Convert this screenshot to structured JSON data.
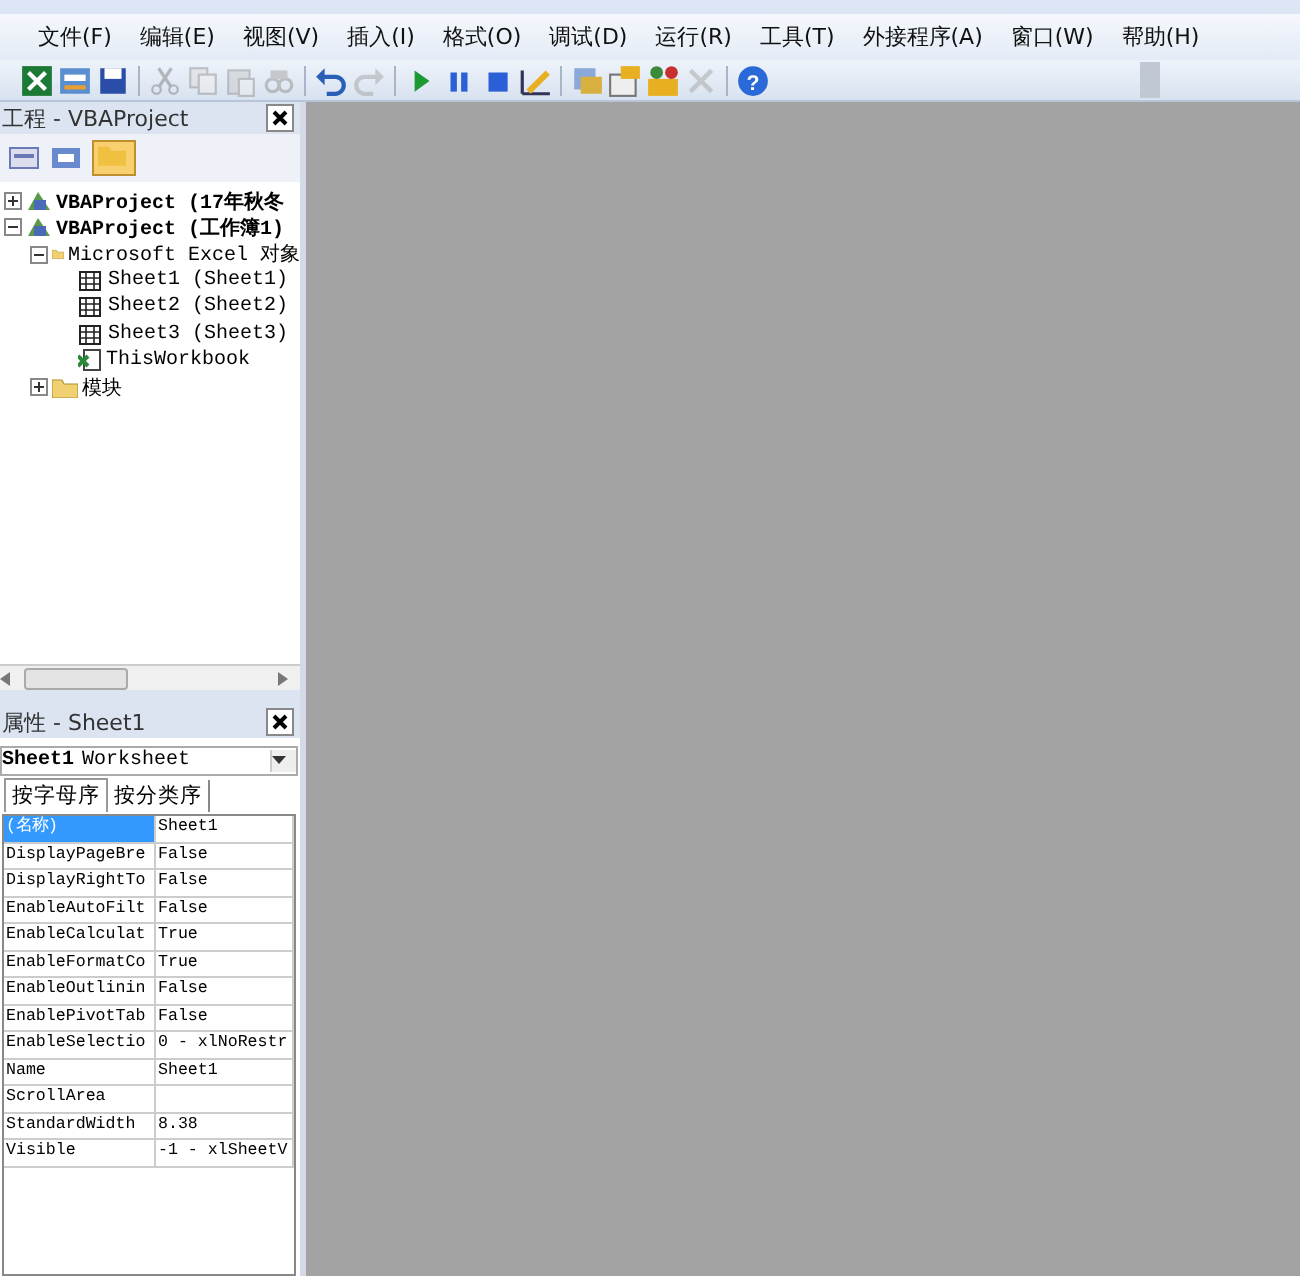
{
  "menu": [
    {
      "label": "文件(F)"
    },
    {
      "label": "编辑(E)"
    },
    {
      "label": "视图(V)"
    },
    {
      "label": "插入(I)"
    },
    {
      "label": "格式(O)"
    },
    {
      "label": "调试(D)"
    },
    {
      "label": "运行(R)"
    },
    {
      "label": "工具(T)"
    },
    {
      "label": "外接程序(A)"
    },
    {
      "label": "窗口(W)"
    },
    {
      "label": "帮助(H)"
    }
  ],
  "toolbar": [
    {
      "kind": "excel",
      "disabled": false
    },
    {
      "kind": "insert",
      "disabled": false
    },
    {
      "kind": "save",
      "disabled": false
    },
    {
      "kind": "sep"
    },
    {
      "kind": "cut",
      "disabled": true
    },
    {
      "kind": "copy",
      "disabled": true
    },
    {
      "kind": "paste",
      "disabled": true
    },
    {
      "kind": "find",
      "disabled": true
    },
    {
      "kind": "sep"
    },
    {
      "kind": "undo",
      "disabled": false
    },
    {
      "kind": "redo",
      "disabled": true
    },
    {
      "kind": "sep"
    },
    {
      "kind": "run",
      "disabled": false
    },
    {
      "kind": "pause",
      "disabled": false
    },
    {
      "kind": "stop",
      "disabled": false
    },
    {
      "kind": "design",
      "disabled": false
    },
    {
      "kind": "sep"
    },
    {
      "kind": "explorer",
      "disabled": false
    },
    {
      "kind": "properties",
      "disabled": false
    },
    {
      "kind": "browser",
      "disabled": false
    },
    {
      "kind": "toolbox",
      "disabled": true
    },
    {
      "kind": "sep"
    },
    {
      "kind": "help",
      "disabled": false,
      "label": "?"
    }
  ],
  "project": {
    "title": "工程 - VBAProject",
    "tree": [
      {
        "label": "VBAProject (17年秋冬",
        "kind": "project",
        "bold": true,
        "expanded": false
      },
      {
        "label": "VBAProject (工作簿1)",
        "kind": "project",
        "bold": true,
        "expanded": true,
        "children": [
          {
            "label": "Microsoft Excel 对象",
            "kind": "folder",
            "bold": false,
            "expanded": true,
            "children": [
              {
                "label": "Sheet1 (Sheet1)",
                "kind": "sheet",
                "bold": false
              },
              {
                "label": "Sheet2 (Sheet2)",
                "kind": "sheet",
                "bold": false
              },
              {
                "label": "Sheet3 (Sheet3)",
                "kind": "sheet",
                "bold": false
              },
              {
                "label": "ThisWorkbook",
                "kind": "workbook",
                "bold": false
              }
            ]
          },
          {
            "label": "模块",
            "kind": "folder",
            "bold": false,
            "expanded": false
          }
        ]
      }
    ]
  },
  "properties": {
    "title": "属性 - Sheet1",
    "object_name": "Sheet1",
    "object_type": "Worksheet",
    "tabs": [
      {
        "label": "按字母序",
        "selected": true
      },
      {
        "label": "按分类序",
        "selected": false
      }
    ],
    "rows": [
      {
        "name": "(名称)",
        "value": "Sheet1",
        "selected": true
      },
      {
        "name": "DisplayPageBre",
        "value": "False",
        "selected": false
      },
      {
        "name": "DisplayRightTo",
        "value": "False",
        "selected": false
      },
      {
        "name": "EnableAutoFilt",
        "value": "False",
        "selected": false
      },
      {
        "name": "EnableCalculat",
        "value": "True",
        "selected": false
      },
      {
        "name": "EnableFormatCo",
        "value": "True",
        "selected": false
      },
      {
        "name": "EnableOutlinin",
        "value": "False",
        "selected": false
      },
      {
        "name": "EnablePivotTab",
        "value": "False",
        "selected": false
      },
      {
        "name": "EnableSelectio",
        "value": "0 - xlNoRestr",
        "selected": false
      },
      {
        "name": "Name",
        "value": "Sheet1",
        "selected": false
      },
      {
        "name": "ScrollArea",
        "value": "",
        "selected": false
      },
      {
        "name": "StandardWidth",
        "value": "8.38",
        "selected": false
      },
      {
        "name": "Visible",
        "value": "-1 - xlSheetV",
        "selected": false
      }
    ]
  }
}
